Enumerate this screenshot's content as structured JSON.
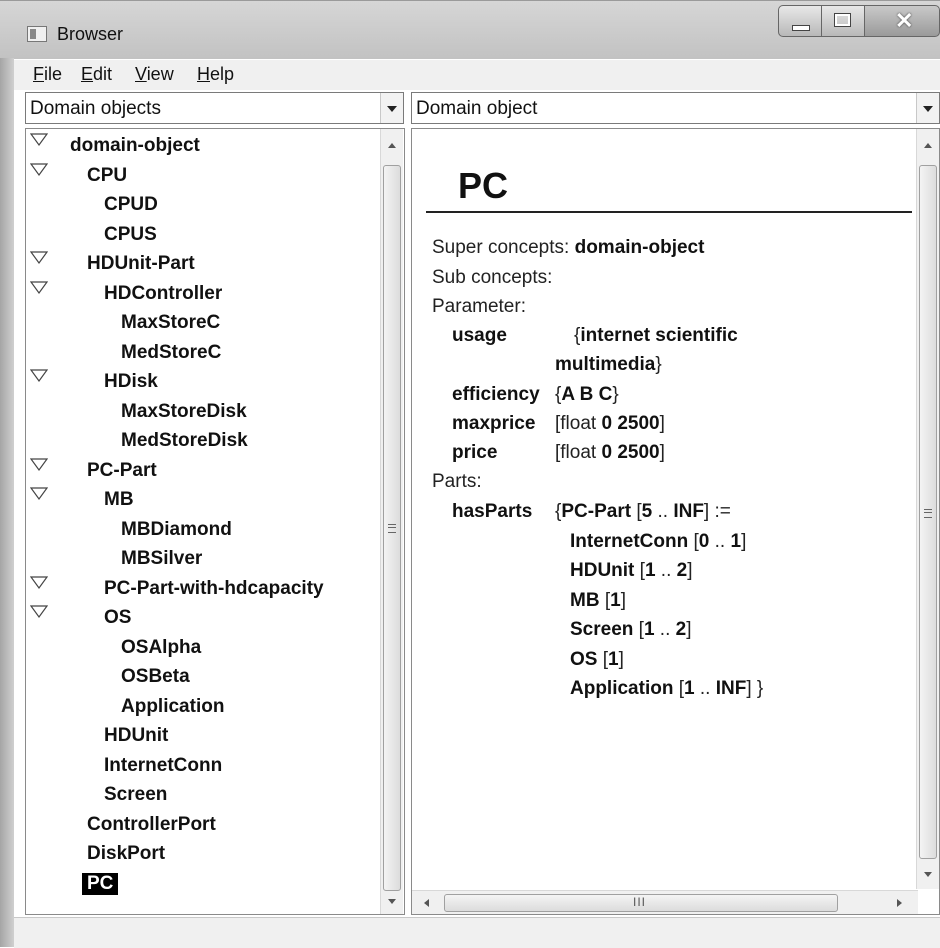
{
  "window": {
    "title": "Browser"
  },
  "menu": {
    "file": "File",
    "edit": "Edit",
    "view": "View",
    "help": "Help"
  },
  "combos": {
    "left": "Domain objects",
    "right": "Domain object"
  },
  "tree": {
    "items": [
      {
        "label": "domain-object",
        "expanded": true
      },
      {
        "label": "CPU",
        "expanded": true
      },
      {
        "label": "CPUD"
      },
      {
        "label": "CPUS"
      },
      {
        "label": "HDUnit-Part",
        "expanded": true
      },
      {
        "label": "HDController",
        "expanded": true
      },
      {
        "label": "MaxStoreC"
      },
      {
        "label": "MedStoreC"
      },
      {
        "label": "HDisk",
        "expanded": true
      },
      {
        "label": "MaxStoreDisk"
      },
      {
        "label": "MedStoreDisk"
      },
      {
        "label": "PC-Part",
        "expanded": true
      },
      {
        "label": "MB",
        "expanded": true
      },
      {
        "label": "MBDiamond"
      },
      {
        "label": "MBSilver"
      },
      {
        "label": "PC-Part-with-hdcapacity",
        "expanded": true
      },
      {
        "label": "OS",
        "expanded": true
      },
      {
        "label": "OSAlpha"
      },
      {
        "label": "OSBeta"
      },
      {
        "label": "Application"
      },
      {
        "label": "HDUnit"
      },
      {
        "label": "InternetConn"
      },
      {
        "label": "Screen"
      },
      {
        "label": "ControllerPort"
      },
      {
        "label": "DiskPort"
      },
      {
        "label": "PC",
        "selected": true
      }
    ]
  },
  "detail": {
    "title": "PC",
    "super_label": "Super concepts: ",
    "super_value": "domain-object",
    "sub_label": "Sub concepts:",
    "parameter_label": "Parameter:",
    "params": {
      "usage": {
        "name": "usage",
        "open": "{",
        "values_line1": "internet scientific",
        "values_line2": "multimedia",
        "close": "}"
      },
      "efficiency": {
        "name": "efficiency",
        "open": "{",
        "values": "A B C",
        "close": "}"
      },
      "maxprice": {
        "name": "maxprice",
        "open": "[float ",
        "values": "0 2500",
        "close": "]"
      },
      "price": {
        "name": "price",
        "open": "[float ",
        "values": "0 2500",
        "close": "]"
      }
    },
    "parts_label": "Parts:",
    "has_parts": {
      "name": "hasParts",
      "lines": [
        {
          "open": "{",
          "bold": "PC-Part",
          "rest": " [",
          "b2": "5",
          "r2": " .. ",
          "b3": "INF",
          "r3": "]  :="
        },
        {
          "open": "",
          "bold": "InternetConn",
          "rest": " [",
          "b2": "0",
          "r2": " .. ",
          "b3": "1",
          "r3": "]"
        },
        {
          "open": "",
          "bold": "HDUnit",
          "rest": " [",
          "b2": "1",
          "r2": " .. ",
          "b3": "2",
          "r3": "]"
        },
        {
          "open": "",
          "bold": "MB",
          "rest": " [",
          "b2": "1",
          "r2": "",
          "b3": "",
          "r3": "]"
        },
        {
          "open": "",
          "bold": "Screen",
          "rest": " [",
          "b2": "1",
          "r2": " .. ",
          "b3": "2",
          "r3": "]"
        },
        {
          "open": "",
          "bold": "OS",
          "rest": " [",
          "b2": "1",
          "r2": "",
          "b3": "",
          "r3": "]"
        },
        {
          "open": "",
          "bold": "Application",
          "rest": " [",
          "b2": "1",
          "r2": " .. ",
          "b3": "INF",
          "r3": "] }"
        }
      ]
    }
  },
  "scroll": {
    "hthumb_grip": "III"
  }
}
